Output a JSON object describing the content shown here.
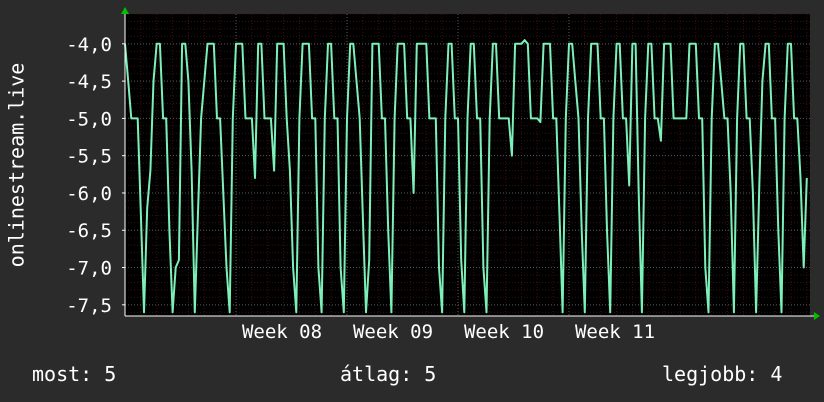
{
  "chart_data": {
    "type": "line",
    "ylabel": "onlinestream.live",
    "ylim": [
      -7.65,
      -3.6
    ],
    "yticks": [
      "-4,0",
      "-4,5",
      "-5,0",
      "-5,5",
      "-6,0",
      "-6,5",
      "-7,0",
      "-7,5"
    ],
    "ytick_values": [
      -4.0,
      -4.5,
      -5.0,
      -5.5,
      -6.0,
      -6.5,
      -7.0,
      -7.5
    ],
    "xlim": [
      0,
      43.2
    ],
    "xticks": [
      "Week 08",
      "Week 09",
      "Week 10",
      "Week 11"
    ],
    "xtick_values": [
      7,
      14,
      21,
      28
    ],
    "colors": {
      "background": "#000000",
      "line": "#7cf0b8",
      "axis": "#ffffff",
      "grid_major": "#5a5a5a",
      "grid_minor": "#3a1010",
      "arrow": "#00c000"
    },
    "series": [
      {
        "values": [
          [
            0.0,
            -4.0
          ],
          [
            0.2,
            -4.5
          ],
          [
            0.4,
            -5.0
          ],
          [
            0.6,
            -5.0
          ],
          [
            0.8,
            -5.0
          ],
          [
            1.0,
            -6.3
          ],
          [
            1.2,
            -7.6
          ],
          [
            1.4,
            -6.2
          ],
          [
            1.6,
            -5.7
          ],
          [
            1.8,
            -4.5
          ],
          [
            2.0,
            -4.0
          ],
          [
            2.2,
            -4.0
          ],
          [
            2.4,
            -5.0
          ],
          [
            2.6,
            -5.0
          ],
          [
            2.8,
            -6.5
          ],
          [
            3.0,
            -7.6
          ],
          [
            3.2,
            -7.0
          ],
          [
            3.4,
            -6.9
          ],
          [
            3.6,
            -4.0
          ],
          [
            3.8,
            -4.0
          ],
          [
            4.0,
            -4.5
          ],
          [
            4.2,
            -5.7
          ],
          [
            4.4,
            -7.6
          ],
          [
            4.6,
            -6.3
          ],
          [
            4.8,
            -5.0
          ],
          [
            5.0,
            -4.5
          ],
          [
            5.2,
            -4.0
          ],
          [
            5.4,
            -4.0
          ],
          [
            5.6,
            -4.0
          ],
          [
            5.8,
            -5.0
          ],
          [
            6.0,
            -5.0
          ],
          [
            6.2,
            -6.0
          ],
          [
            6.4,
            -7.0
          ],
          [
            6.6,
            -7.6
          ],
          [
            6.8,
            -5.0
          ],
          [
            7.0,
            -4.0
          ],
          [
            7.2,
            -4.0
          ],
          [
            7.4,
            -4.0
          ],
          [
            7.6,
            -5.0
          ],
          [
            7.8,
            -5.0
          ],
          [
            8.0,
            -5.0
          ],
          [
            8.2,
            -5.8
          ],
          [
            8.4,
            -4.0
          ],
          [
            8.6,
            -4.0
          ],
          [
            8.8,
            -5.0
          ],
          [
            9.0,
            -5.0
          ],
          [
            9.2,
            -5.0
          ],
          [
            9.4,
            -5.7
          ],
          [
            9.6,
            -4.0
          ],
          [
            9.8,
            -4.0
          ],
          [
            10.0,
            -4.0
          ],
          [
            10.2,
            -5.0
          ],
          [
            10.4,
            -5.7
          ],
          [
            10.6,
            -7.0
          ],
          [
            10.8,
            -7.6
          ],
          [
            11.0,
            -5.0
          ],
          [
            11.2,
            -4.0
          ],
          [
            11.4,
            -4.0
          ],
          [
            11.6,
            -4.0
          ],
          [
            11.8,
            -5.0
          ],
          [
            12.0,
            -5.0
          ],
          [
            12.2,
            -7.0
          ],
          [
            12.4,
            -7.6
          ],
          [
            12.6,
            -5.0
          ],
          [
            12.8,
            -4.0
          ],
          [
            13.0,
            -4.0
          ],
          [
            13.2,
            -5.0
          ],
          [
            13.4,
            -5.0
          ],
          [
            13.6,
            -7.0
          ],
          [
            13.8,
            -7.6
          ],
          [
            14.0,
            -5.0
          ],
          [
            14.2,
            -4.0
          ],
          [
            14.4,
            -4.0
          ],
          [
            14.6,
            -4.5
          ],
          [
            14.8,
            -5.0
          ],
          [
            15.0,
            -6.3
          ],
          [
            15.2,
            -7.6
          ],
          [
            15.4,
            -6.9
          ],
          [
            15.6,
            -4.0
          ],
          [
            15.8,
            -4.0
          ],
          [
            16.0,
            -4.0
          ],
          [
            16.2,
            -5.0
          ],
          [
            16.4,
            -5.0
          ],
          [
            16.6,
            -6.5
          ],
          [
            16.8,
            -7.6
          ],
          [
            17.0,
            -5.0
          ],
          [
            17.2,
            -4.0
          ],
          [
            17.4,
            -4.0
          ],
          [
            17.6,
            -4.0
          ],
          [
            17.8,
            -5.0
          ],
          [
            18.0,
            -5.0
          ],
          [
            18.2,
            -6.0
          ],
          [
            18.4,
            -4.0
          ],
          [
            18.6,
            -4.0
          ],
          [
            18.8,
            -4.0
          ],
          [
            19.0,
            -4.0
          ],
          [
            19.2,
            -5.0
          ],
          [
            19.4,
            -5.0
          ],
          [
            19.6,
            -5.0
          ],
          [
            19.8,
            -7.0
          ],
          [
            20.0,
            -7.6
          ],
          [
            20.2,
            -5.0
          ],
          [
            20.4,
            -4.0
          ],
          [
            20.6,
            -4.0
          ],
          [
            20.8,
            -5.0
          ],
          [
            21.0,
            -5.0
          ],
          [
            21.2,
            -6.9
          ],
          [
            21.4,
            -7.6
          ],
          [
            21.6,
            -5.0
          ],
          [
            21.8,
            -4.0
          ],
          [
            22.0,
            -4.0
          ],
          [
            22.2,
            -5.0
          ],
          [
            22.4,
            -5.0
          ],
          [
            22.6,
            -7.0
          ],
          [
            22.8,
            -7.6
          ],
          [
            23.0,
            -5.0
          ],
          [
            23.2,
            -4.0
          ],
          [
            23.4,
            -4.0
          ],
          [
            23.6,
            -5.0
          ],
          [
            23.8,
            -5.0
          ],
          [
            24.0,
            -5.0
          ],
          [
            24.2,
            -5.0
          ],
          [
            24.4,
            -5.5
          ],
          [
            24.6,
            -4.0
          ],
          [
            24.8,
            -4.0
          ],
          [
            25.0,
            -4.0
          ],
          [
            25.2,
            -3.95
          ],
          [
            25.4,
            -4.0
          ],
          [
            25.6,
            -5.0
          ],
          [
            25.8,
            -5.0
          ],
          [
            26.0,
            -5.0
          ],
          [
            26.2,
            -5.05
          ],
          [
            26.4,
            -4.0
          ],
          [
            26.6,
            -4.0
          ],
          [
            26.8,
            -4.0
          ],
          [
            27.0,
            -5.0
          ],
          [
            27.2,
            -5.0
          ],
          [
            27.4,
            -6.3
          ],
          [
            27.6,
            -7.6
          ],
          [
            27.8,
            -5.0
          ],
          [
            28.0,
            -4.0
          ],
          [
            28.2,
            -4.0
          ],
          [
            28.4,
            -4.5
          ],
          [
            28.6,
            -5.0
          ],
          [
            28.8,
            -6.5
          ],
          [
            29.0,
            -7.6
          ],
          [
            29.2,
            -5.0
          ],
          [
            29.4,
            -4.0
          ],
          [
            29.6,
            -4.0
          ],
          [
            29.8,
            -4.0
          ],
          [
            30.0,
            -5.0
          ],
          [
            30.2,
            -5.0
          ],
          [
            30.4,
            -6.5
          ],
          [
            30.6,
            -7.6
          ],
          [
            30.8,
            -5.0
          ],
          [
            31.0,
            -4.0
          ],
          [
            31.2,
            -4.0
          ],
          [
            31.4,
            -5.0
          ],
          [
            31.6,
            -5.0
          ],
          [
            31.8,
            -5.9
          ],
          [
            32.0,
            -4.0
          ],
          [
            32.2,
            -4.0
          ],
          [
            32.4,
            -6.0
          ],
          [
            32.6,
            -7.6
          ],
          [
            32.8,
            -5.0
          ],
          [
            33.0,
            -4.0
          ],
          [
            33.2,
            -4.0
          ],
          [
            33.4,
            -5.0
          ],
          [
            33.6,
            -5.0
          ],
          [
            33.8,
            -5.3
          ],
          [
            34.0,
            -4.0
          ],
          [
            34.2,
            -4.0
          ],
          [
            34.4,
            -4.0
          ],
          [
            34.6,
            -5.0
          ],
          [
            34.8,
            -5.0
          ],
          [
            35.0,
            -5.0
          ],
          [
            35.2,
            -5.0
          ],
          [
            35.4,
            -5.0
          ],
          [
            35.6,
            -4.0
          ],
          [
            35.8,
            -4.0
          ],
          [
            36.0,
            -4.0
          ],
          [
            36.2,
            -5.0
          ],
          [
            36.4,
            -5.0
          ],
          [
            36.6,
            -7.0
          ],
          [
            36.8,
            -7.6
          ],
          [
            37.0,
            -5.0
          ],
          [
            37.2,
            -4.0
          ],
          [
            37.4,
            -4.0
          ],
          [
            37.6,
            -4.5
          ],
          [
            37.8,
            -5.0
          ],
          [
            38.0,
            -5.0
          ],
          [
            38.2,
            -6.0
          ],
          [
            38.4,
            -7.6
          ],
          [
            38.6,
            -5.0
          ],
          [
            38.8,
            -4.0
          ],
          [
            39.0,
            -4.0
          ],
          [
            39.2,
            -5.0
          ],
          [
            39.4,
            -5.0
          ],
          [
            39.6,
            -6.0
          ],
          [
            39.8,
            -7.6
          ],
          [
            40.0,
            -5.9
          ],
          [
            40.2,
            -4.5
          ],
          [
            40.4,
            -4.0
          ],
          [
            40.6,
            -4.0
          ],
          [
            40.8,
            -5.0
          ],
          [
            41.0,
            -5.0
          ],
          [
            41.2,
            -6.5
          ],
          [
            41.4,
            -7.6
          ],
          [
            41.6,
            -5.0
          ],
          [
            41.8,
            -4.0
          ],
          [
            42.0,
            -4.0
          ],
          [
            42.2,
            -5.0
          ],
          [
            42.4,
            -5.0
          ],
          [
            42.6,
            -5.8
          ],
          [
            42.8,
            -7.0
          ],
          [
            43.0,
            -5.8
          ]
        ]
      }
    ]
  },
  "footer": {
    "current_label": "most: 5",
    "average_label": "átlag: 5",
    "max_label": "legjobb: 4"
  }
}
